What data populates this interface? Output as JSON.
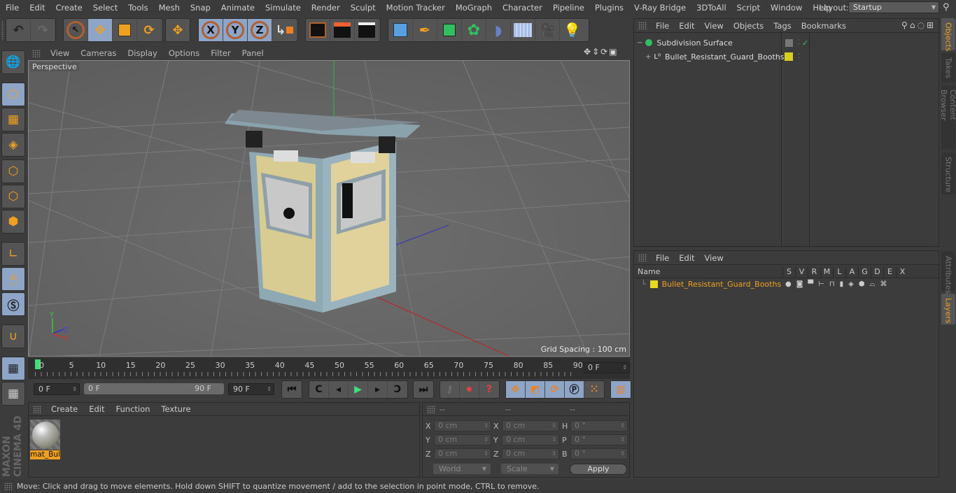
{
  "menubar": {
    "items": [
      "File",
      "Edit",
      "Create",
      "Select",
      "Tools",
      "Mesh",
      "Snap",
      "Animate",
      "Simulate",
      "Render",
      "Sculpt",
      "Motion Tracker",
      "MoGraph",
      "Character",
      "Pipeline",
      "Plugins",
      "V-Ray Bridge",
      "3DToAll",
      "Script",
      "Window",
      "Help"
    ],
    "layout_label": "Layout:",
    "layout_value": "Startup"
  },
  "toolbar": {
    "icons": [
      "undo-icon",
      "redo-icon",
      "live-selection-icon",
      "move-icon",
      "scale-icon",
      "rotate-icon",
      "last-tool-icon",
      "x-axis-icon",
      "y-axis-icon",
      "z-axis-icon",
      "coordinate-system-icon",
      "render-view-icon",
      "render-picture-viewer-icon",
      "render-settings-icon",
      "cube-icon",
      "pen-icon",
      "subdivision-icon",
      "cloner-icon",
      "bend-deformer-icon",
      "floor-icon",
      "camera-icon",
      "light-icon"
    ],
    "axis_labels": [
      "X",
      "Y",
      "Z"
    ]
  },
  "left_toolbar": {
    "icons": [
      "make-editable-icon",
      "model-mode-icon",
      "texture-mode-icon",
      "workplane-mode-icon",
      "points-mode-icon",
      "edges-mode-icon",
      "polygons-mode-icon",
      "axis-mode-icon",
      "tweak-mode-icon",
      "solo-icon",
      "snap-icon",
      "workplane-lock-icon",
      "workplane-align-icon"
    ],
    "brand": "MAXON CINEMA 4D"
  },
  "viewport": {
    "menu": [
      "View",
      "Cameras",
      "Display",
      "Options",
      "Filter",
      "Panel"
    ],
    "label": "Perspective",
    "grid_spacing": "Grid Spacing : 100 cm",
    "nav_icons": [
      "move-view-icon",
      "dolly-icon",
      "rotate-view-icon",
      "maximize-view-icon"
    ],
    "axis_gizmo": [
      "Y",
      "Z",
      "X"
    ]
  },
  "timeline": {
    "ticks": [
      "0",
      "5",
      "10",
      "15",
      "20",
      "25",
      "30",
      "35",
      "40",
      "45",
      "50",
      "55",
      "60",
      "65",
      "70",
      "75",
      "80",
      "85",
      "90"
    ],
    "current_frame": "0 F",
    "start_field": "0 F",
    "range_start": "0 F",
    "range_end": "90 F",
    "end_field": "90 F",
    "playback_icons": [
      "go-to-start-icon",
      "previous-key-icon",
      "previous-frame-icon",
      "play-icon",
      "next-frame-icon",
      "next-key-icon",
      "go-to-end-icon",
      "record-keys-icon",
      "autokey-icon",
      "keyframe-selection-icon",
      "position-key-icon",
      "scale-key-icon",
      "rotation-key-icon",
      "parameter-key-icon",
      "point-level-icon",
      "timeline-icon"
    ]
  },
  "material_manager": {
    "menu": [
      "Create",
      "Edit",
      "Function",
      "Texture"
    ],
    "materials": [
      {
        "name": "mat_Bul"
      }
    ]
  },
  "coordinates": {
    "header": [
      "--",
      "--",
      "--"
    ],
    "rows": [
      {
        "l1": "X",
        "v1": "0 cm",
        "l2": "X",
        "v2": "0 cm",
        "l3": "H",
        "v3": "0 °"
      },
      {
        "l1": "Y",
        "v1": "0 cm",
        "l2": "Y",
        "v2": "0 cm",
        "l3": "P",
        "v3": "0 °"
      },
      {
        "l1": "Z",
        "v1": "0 cm",
        "l2": "Z",
        "v2": "0 cm",
        "l3": "B",
        "v3": "0 °"
      }
    ],
    "mode_select": "World",
    "size_select": "Scale",
    "apply_label": "Apply"
  },
  "object_manager": {
    "menu": [
      "File",
      "Edit",
      "View",
      "Objects",
      "Tags",
      "Bookmarks"
    ],
    "objects": [
      {
        "name": "Subdivision Surface",
        "expand": "−",
        "check": "✓"
      },
      {
        "name": "Bullet_Resistant_Guard_Booths",
        "expand": "+",
        "layer_color": "#d8d020"
      }
    ]
  },
  "layer_manager": {
    "menu": [
      "File",
      "Edit",
      "View"
    ],
    "columns": [
      "Name",
      "S",
      "V",
      "R",
      "M",
      "L",
      "A",
      "G",
      "D",
      "E",
      "X"
    ],
    "layers": [
      {
        "name": "Bullet_Resistant_Guard_Booths",
        "color": "#e8d820"
      }
    ]
  },
  "side_tabs": [
    "Objects",
    "Takes",
    "Content Browser",
    "Structure",
    "Attributes",
    "Layers"
  ],
  "status_bar": {
    "text": "Move: Click and drag to move elements. Hold down SHIFT to quantize movement / add to the selection in point mode, CTRL to remove."
  },
  "colors": {
    "accent": "#f0a020",
    "selected_tool": "#8ea5c8",
    "playhead": "#3ee07a"
  }
}
